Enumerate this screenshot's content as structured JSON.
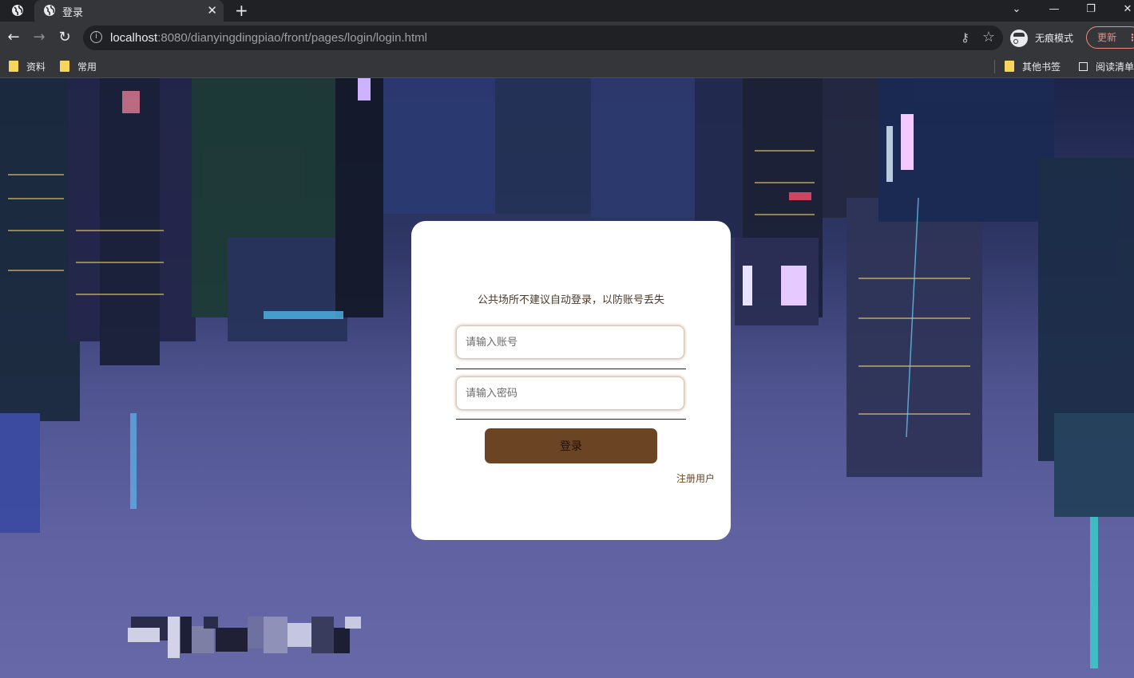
{
  "browser": {
    "tab_title": "登录",
    "url_host": "localhost",
    "url_rest": ":8080/dianyingdingpiao/front/pages/login/login.html",
    "incognito_label": "无痕模式",
    "update_label": "更新",
    "bookmarks": [
      {
        "label": "资料",
        "icon": "folder-icon"
      },
      {
        "label": "常用",
        "icon": "folder-icon"
      }
    ],
    "bookmarks_right": [
      {
        "label": "其他书签",
        "icon": "folder-icon"
      },
      {
        "label": "阅读清单",
        "icon": "reading-list-icon"
      }
    ]
  },
  "login": {
    "notice": "公共场所不建议自动登录，以防账号丢失",
    "account_placeholder": "请输入账号",
    "password_placeholder": "请输入密码",
    "login_button": "登录",
    "register_link": "注册用户"
  },
  "colors": {
    "button_bg": "#6b4423",
    "link": "#6b4423",
    "card_bg": "#ffffff"
  }
}
